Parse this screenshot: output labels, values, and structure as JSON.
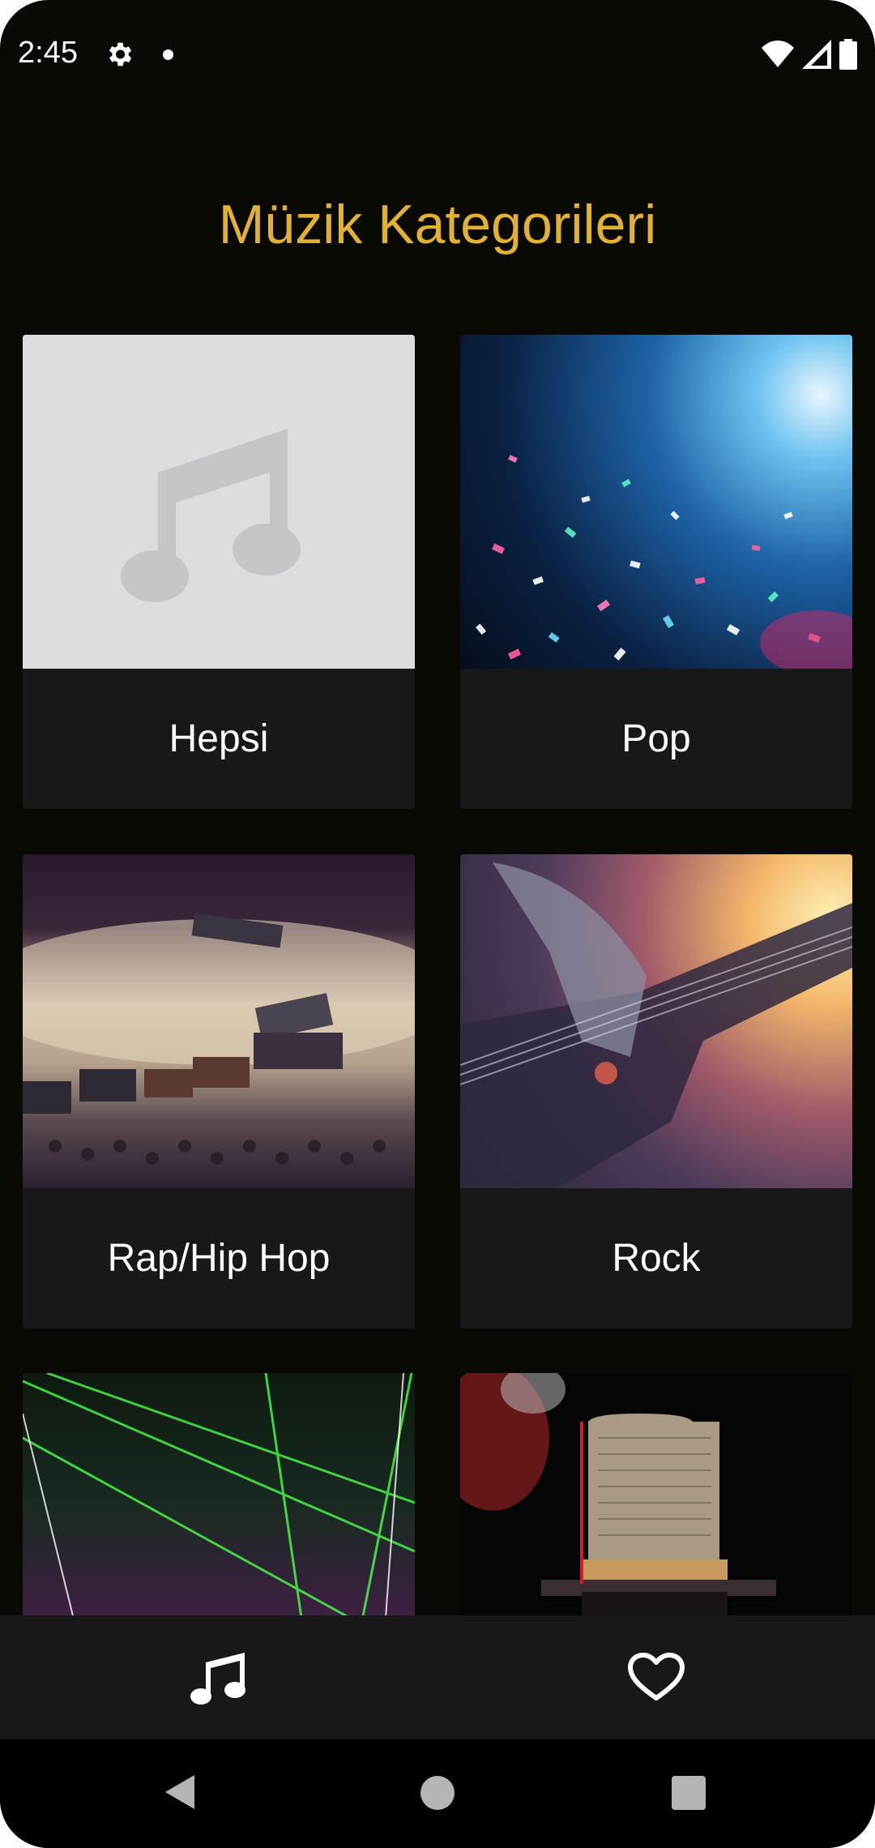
{
  "status_bar": {
    "time": "2:45",
    "icons": [
      "gear-icon",
      "notification-dot-icon",
      "wifi-icon",
      "signal-icon",
      "battery-icon"
    ]
  },
  "page": {
    "title": "Müzik Kategorileri",
    "title_color": "#e1b134"
  },
  "categories": [
    {
      "label": "Hepsi",
      "image": "music-note-placeholder"
    },
    {
      "label": "Pop",
      "image": "confetti-concert-photo"
    },
    {
      "label": "Rap/Hip Hop",
      "image": "audio-gear-table-photo"
    },
    {
      "label": "Rock",
      "image": "electric-guitar-photo"
    },
    {
      "label": "",
      "image": "laser-show-photo"
    },
    {
      "label": "",
      "image": "microphone-photo"
    }
  ],
  "bottom_nav": {
    "items": [
      {
        "icon": "music-note-icon",
        "active": true
      },
      {
        "icon": "heart-outline-icon",
        "active": false
      }
    ]
  },
  "system_nav": {
    "buttons": [
      "back-icon",
      "home-icon",
      "recents-icon"
    ]
  },
  "colors": {
    "background": "#0a0a05",
    "card": "#181818",
    "placeholder": "#dcdce1"
  }
}
